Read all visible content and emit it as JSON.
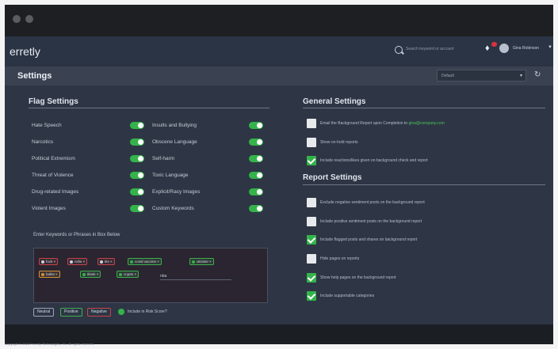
{
  "app": {
    "brand": "erretly"
  },
  "header": {
    "search_placeholder": "Search keyword or account",
    "username": "Gina Robinson"
  },
  "page": {
    "title": "Settings",
    "select_value": "Default"
  },
  "flag_settings": {
    "title": "Flag Settings",
    "left": [
      {
        "label": "Hate Speech",
        "on": true
      },
      {
        "label": "Narcotics",
        "on": true
      },
      {
        "label": "Political Extremism",
        "on": true
      },
      {
        "label": "Threat of Violence",
        "on": true
      },
      {
        "label": "Drug-related Images",
        "on": true
      },
      {
        "label": "Violent Images",
        "on": true
      }
    ],
    "right": [
      {
        "label": "Insults and Bullying",
        "on": true
      },
      {
        "label": "Obscene Language",
        "on": true
      },
      {
        "label": "Self-harm",
        "on": true
      },
      {
        "label": "Toxic Language",
        "on": true
      },
      {
        "label": "Explicit/Racy Images",
        "on": true
      },
      {
        "label": "Custom Keywords",
        "on": true
      }
    ]
  },
  "keywords": {
    "label": "Enter Keywords or Phrases in Box Below",
    "chips": [
      {
        "text": "fuck",
        "kind": "blk"
      },
      {
        "text": "nsfw",
        "kind": "blk"
      },
      {
        "text": "tits",
        "kind": "blk"
      },
      {
        "text": "covid vaccine",
        "kind": "pos"
      },
      {
        "text": "ukraine",
        "kind": "pos"
      },
      {
        "text": "ballot",
        "kind": "neg"
      },
      {
        "text": "tiktok",
        "kind": "pos"
      },
      {
        "text": "crypto",
        "kind": "pos"
      }
    ],
    "entry_value": "nba",
    "legend": [
      "Neutral",
      "Positive",
      "Negative"
    ],
    "case_label": "Include in Risk Score?"
  },
  "general_settings": {
    "title": "General Settings",
    "options": [
      {
        "text": "Email the Background Report upon Completion to",
        "link": "gina@company.com",
        "checked": false
      },
      {
        "text": "Show on-hold reports",
        "link": "",
        "checked": false
      },
      {
        "text": "Include reactions/likes given on background check and report",
        "link": "",
        "checked": true
      }
    ]
  },
  "report_settings": {
    "title": "Report Settings",
    "options": [
      {
        "text": "Exclude negative sentiment posts on the background report",
        "checked": false
      },
      {
        "text": "Include positive sentiment posts on the background report",
        "checked": false
      },
      {
        "text": "Include flagged posts and shares on background report",
        "checked": true
      },
      {
        "text": "Hide pages on reports",
        "checked": false
      },
      {
        "text": "Show help pages on the background report",
        "checked": true
      },
      {
        "text": "Include supportable categories",
        "checked": true
      }
    ]
  },
  "footer": {
    "copyright": "Copyright © 2023 Ferretly Technologies, Inc. All rights reserved."
  },
  "colors": {
    "accent": "#34b34a",
    "panel": "#2e3645",
    "navbar": "#2b3444"
  }
}
